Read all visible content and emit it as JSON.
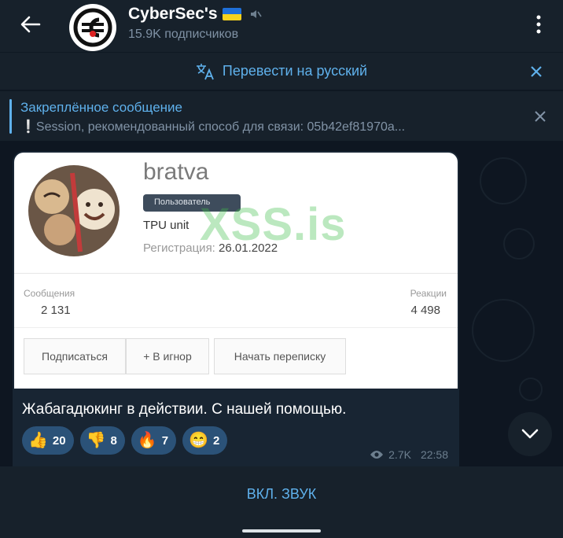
{
  "header": {
    "title": "CyberSec's",
    "subtitle": "15.9K подписчиков",
    "muted_icon": "muted-speaker-icon",
    "flag": "ukraine-flag"
  },
  "translate_bar": {
    "label": "Перевести на русский"
  },
  "pinned": {
    "title": "Закреплённое сообщение",
    "text": "❕Session, рекомендованный способ для связи:  05b42ef81970a..."
  },
  "message": {
    "screenshot": {
      "name": "bratva",
      "badge": "Пользователь",
      "role": "TPU unit",
      "reg_label": "Регистрация:",
      "reg_date": "26.01.2022",
      "watermark": "XSS.is",
      "messages_label": "Сообщения",
      "messages_value": "2 131",
      "reactions_label": "Реакции",
      "reactions_value": "4 498",
      "buttons": [
        "Подписаться",
        "+ В игнор",
        "Начать переписку"
      ]
    },
    "caption": "Жабагадюкинг в действии. С нашей помощью.",
    "reactions": [
      {
        "emoji": "👍",
        "count": "20"
      },
      {
        "emoji": "👎",
        "count": "8"
      },
      {
        "emoji": "🔥",
        "count": "7"
      },
      {
        "emoji": "😁",
        "count": "2"
      }
    ],
    "views": "2.7K",
    "time": "22:58"
  },
  "bottom": {
    "unmute_label": "ВКЛ. ЗВУК"
  },
  "colors": {
    "background": "#0e1621",
    "panel": "#17212b",
    "accent": "#5fb1ec",
    "bubble": "#182533",
    "reaction": "#2b5278"
  }
}
